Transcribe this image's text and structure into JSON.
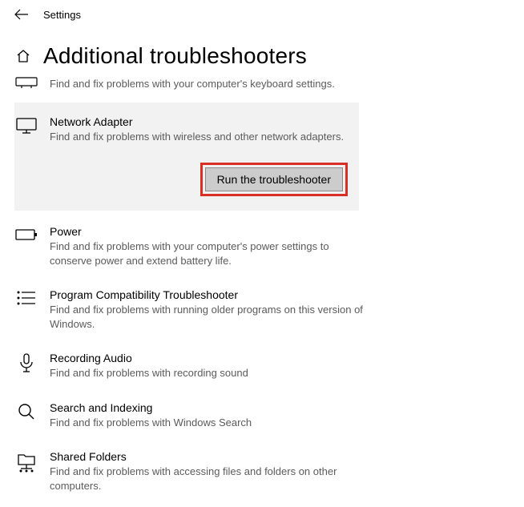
{
  "app_title": "Settings",
  "page_title": "Additional troubleshooters",
  "keyboard_desc": "Find and fix problems with your computer's keyboard settings.",
  "selected": {
    "title": "Network Adapter",
    "desc": "Find and fix problems with wireless and other network adapters.",
    "button": "Run the troubleshooter"
  },
  "items": [
    {
      "title": "Power",
      "desc": "Find and fix problems with your computer's power settings to conserve power and extend battery life."
    },
    {
      "title": "Program Compatibility Troubleshooter",
      "desc": "Find and fix problems with running older programs on this version of Windows."
    },
    {
      "title": "Recording Audio",
      "desc": "Find and fix problems with recording sound"
    },
    {
      "title": "Search and Indexing",
      "desc": "Find and fix problems with Windows Search"
    },
    {
      "title": "Shared Folders",
      "desc": "Find and fix problems with accessing files and folders on other computers."
    }
  ]
}
